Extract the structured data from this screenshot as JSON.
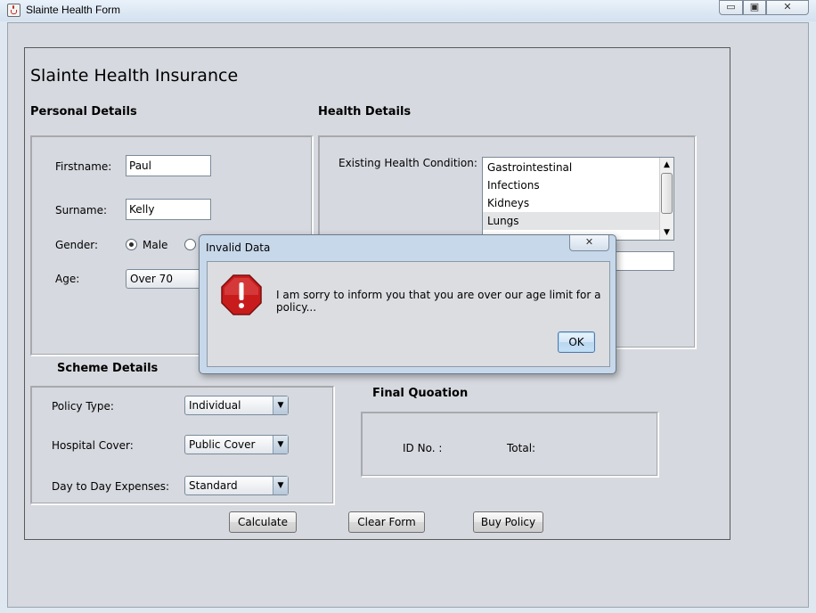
{
  "window": {
    "title": "Slainte Health Form",
    "min_glyph": "▭",
    "max_glyph": "▣",
    "close_glyph": "✕"
  },
  "form": {
    "heading": "Slainte Health Insurance"
  },
  "personal": {
    "title": "Personal Details",
    "firstname_label": "Firstname:",
    "firstname_value": "Paul",
    "surname_label": "Surname:",
    "surname_value": "Kelly",
    "gender_label": "Gender:",
    "gender_male": "Male",
    "gender_selected": "Male",
    "age_label": "Age:",
    "age_value": "Over 70"
  },
  "health": {
    "title": "Health Details",
    "condition_label": "Existing Health Condition:",
    "conditions": [
      "Gastrointestinal",
      "Infections",
      "Kidneys",
      "Lungs"
    ],
    "selected_condition": "Lungs"
  },
  "scheme": {
    "title": "Scheme Details",
    "policy_type_label": "Policy Type:",
    "policy_type_value": "Individual",
    "hospital_cover_label": "Hospital Cover:",
    "hospital_cover_value": "Public Cover",
    "day_expenses_label": "Day to Day Expenses:",
    "day_expenses_value": "Standard"
  },
  "quote": {
    "title": "Final Quoation",
    "id_label": "ID No. :",
    "total_label": "Total:"
  },
  "buttons": {
    "calculate": "Calculate",
    "clear": "Clear Form",
    "buy": "Buy Policy"
  },
  "dialog": {
    "title": "Invalid Data",
    "message": "I am sorry to inform you that you are over our age limit for a policy...",
    "ok": "OK",
    "icon": "error-icon"
  },
  "colors": {
    "panel_bg": "#d6d9df",
    "dialog_frame": "#c7d8ea",
    "error_red": "#c81c1c"
  }
}
